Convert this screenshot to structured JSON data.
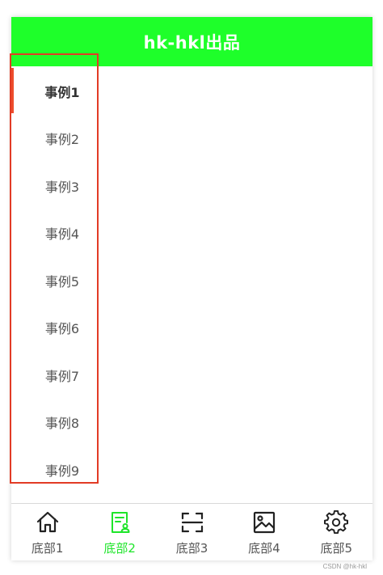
{
  "header": {
    "title": "hk-hkl出品"
  },
  "sidebar": {
    "items": [
      {
        "label": "事例1",
        "active": true
      },
      {
        "label": "事例2"
      },
      {
        "label": "事例3"
      },
      {
        "label": "事例4"
      },
      {
        "label": "事例5"
      },
      {
        "label": "事例6"
      },
      {
        "label": "事例7"
      },
      {
        "label": "事例8"
      },
      {
        "label": "事例9"
      }
    ]
  },
  "tabbar": {
    "items": [
      {
        "label": "底部1",
        "icon": "home-icon"
      },
      {
        "label": "底部2",
        "icon": "document-user-icon",
        "active": true
      },
      {
        "label": "底部3",
        "icon": "scan-icon"
      },
      {
        "label": "底部4",
        "icon": "image-icon"
      },
      {
        "label": "底部5",
        "icon": "gear-icon"
      }
    ]
  },
  "watermark": "CSDN @hk-hkl",
  "colors": {
    "header_bg": "#1EFF2A",
    "active_tab": "#1EE52A",
    "indicator": "#ee4d2d",
    "annotation_box": "#e23b25"
  }
}
